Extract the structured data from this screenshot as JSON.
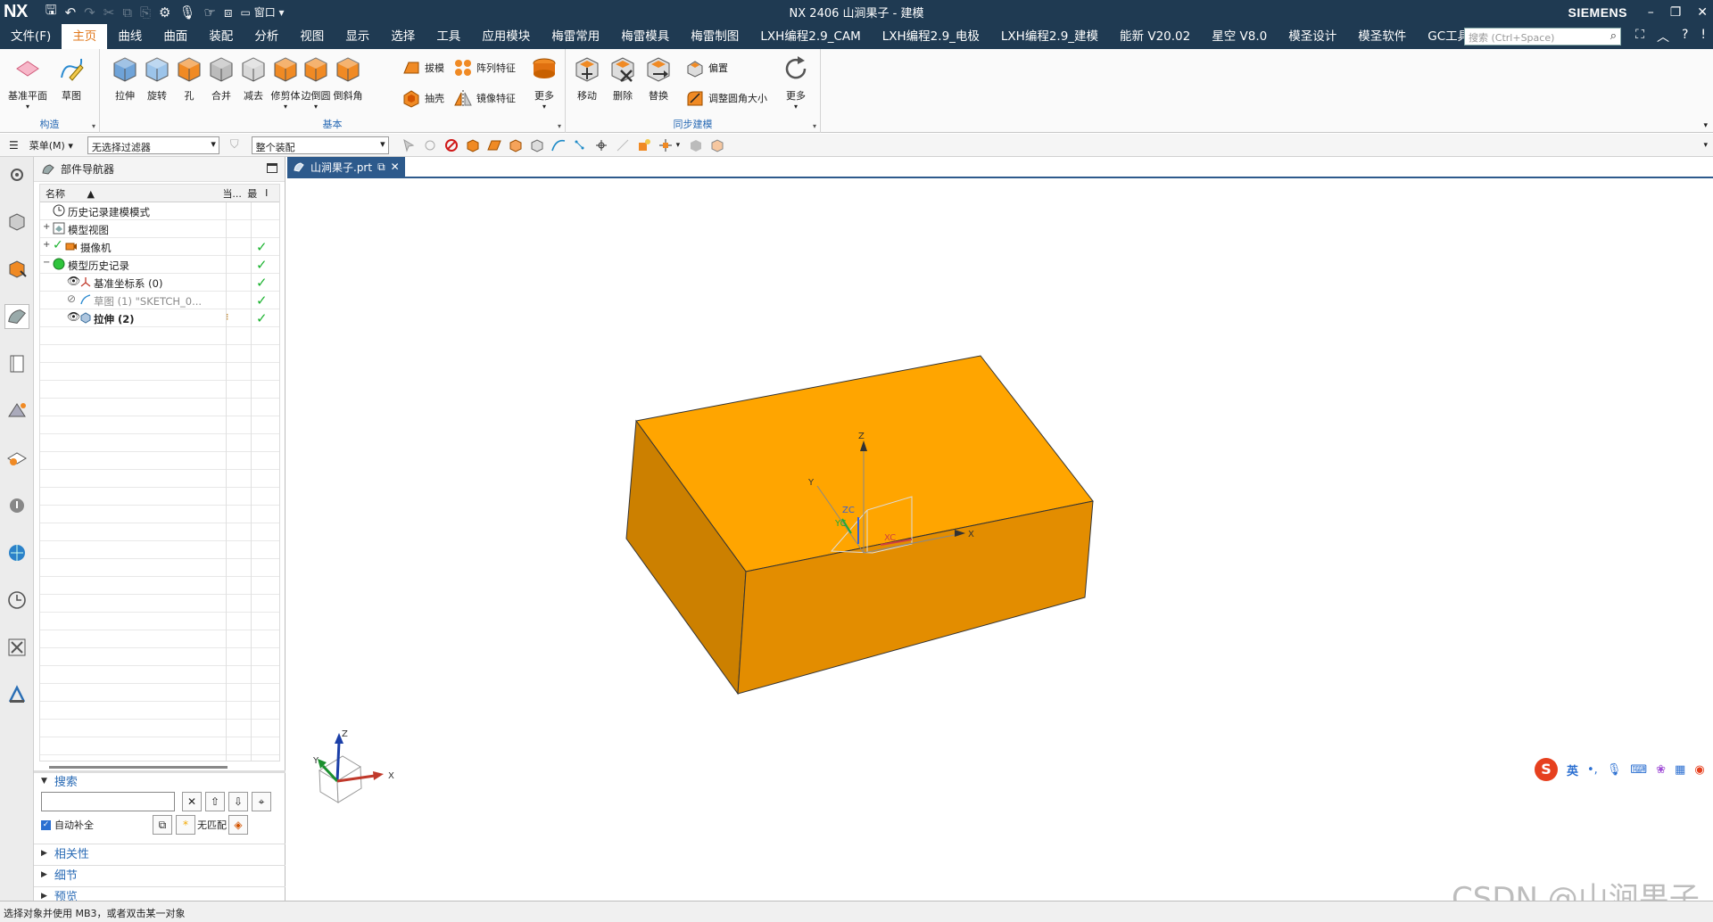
{
  "window": {
    "logo": "NX",
    "title": "NX 2406 山涧果子 - 建模",
    "brand": "SIEMENS",
    "window_menu_label": "窗口"
  },
  "menubar": {
    "tabs": [
      "文件(F)",
      "主页",
      "曲线",
      "曲面",
      "装配",
      "分析",
      "视图",
      "显示",
      "选择",
      "工具",
      "应用模块",
      "梅雷常用",
      "梅雷模具",
      "梅雷制图",
      "LXH编程2.9_CAM",
      "LXH编程2.9_电极",
      "LXH编程2.9_建模",
      "能新 V20.02",
      "星空 V8.0",
      "模圣设计",
      "模圣软件",
      "GC工具箱"
    ],
    "active_tab": "主页",
    "search_placeholder": "搜索 (Ctrl+Space)"
  },
  "ribbon": {
    "groups": [
      {
        "label": "构造",
        "tools": [
          "基准平面",
          "草图"
        ]
      },
      {
        "label": "基本",
        "tools": [
          "拉伸",
          "旋转",
          "孔",
          "合并",
          "减去",
          "修剪体",
          "边倒圆",
          "倒斜角"
        ],
        "small_tools": [
          "拔模",
          "阵列特征",
          "抽壳",
          "镜像特征"
        ],
        "more": "更多"
      },
      {
        "label": "同步建模",
        "tools": [
          "移动",
          "删除",
          "替换"
        ],
        "small_tools": [
          "偏置",
          "调整圆角大小"
        ],
        "more": "更多"
      }
    ]
  },
  "selection_bar": {
    "menu_label": "菜单(M)",
    "filter_value": "无选择过滤器",
    "scope_value": "整个装配"
  },
  "part_navigator": {
    "title": "部件导航器",
    "columns": [
      "名称",
      "当...",
      "最",
      "I"
    ],
    "rows": [
      {
        "label": "历史记录建模模式",
        "check": false
      },
      {
        "label": "模型视图",
        "check": false
      },
      {
        "label": "摄像机",
        "check": true
      },
      {
        "label": "模型历史记录",
        "check": true
      },
      {
        "label": "基准坐标系 (0)",
        "check": true
      },
      {
        "label": "草图 (1) \"SKETCH_0...",
        "check": true
      },
      {
        "label": "拉伸 (2)",
        "check": true
      }
    ],
    "search_section": "搜索",
    "auto_complete_label": "自动补全",
    "no_match_label": "无匹配",
    "sections": [
      "相关性",
      "细节",
      "预览"
    ]
  },
  "document_tab": {
    "label": "山涧果子.prt"
  },
  "viewport": {
    "body_color": "#ffa500",
    "triad_labels": {
      "z": "Z",
      "y": "Y",
      "x": "X"
    },
    "csys_labels": {
      "z": "Z",
      "y": "Y",
      "x": "X",
      "zc": "ZC",
      "yc": "YC",
      "xc": "XC"
    }
  },
  "ime": {
    "label": "英"
  },
  "status": {
    "message": "选择对象并使用 MB3，或者双击某一对象"
  },
  "watermark": "CSDN @山涧果子"
}
